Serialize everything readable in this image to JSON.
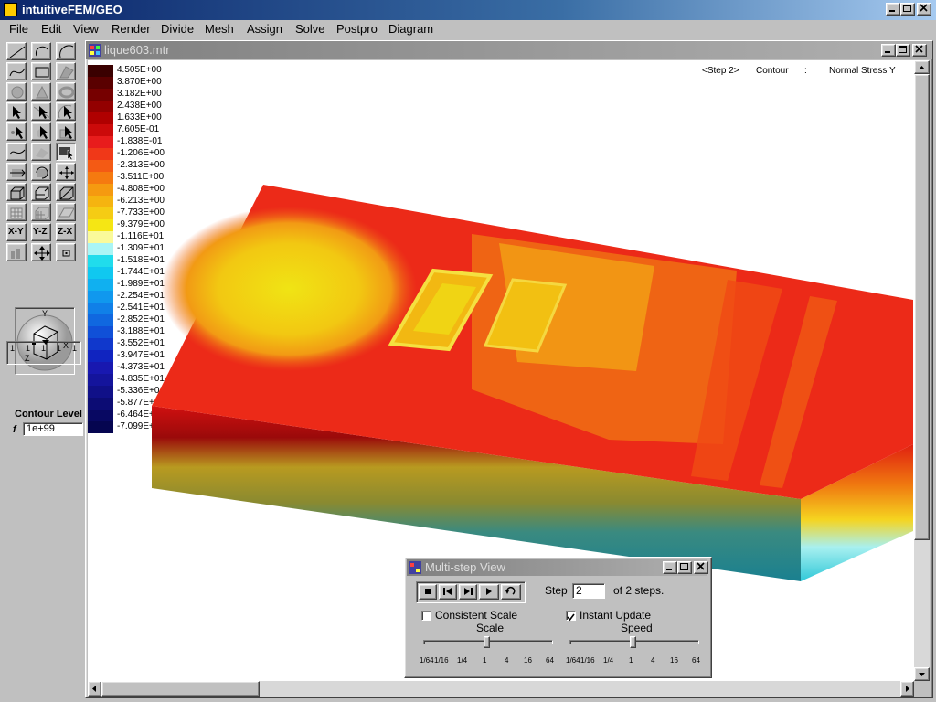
{
  "app": {
    "title": "intuitiveFEM/GEO"
  },
  "menu": [
    "File",
    "Edit",
    "View",
    "Render",
    "Divide",
    "Mesh",
    "Assign",
    "Solve",
    "Postpro",
    "Diagram"
  ],
  "document": {
    "title": "lique603.mtr"
  },
  "status": {
    "step": "<Step 2>",
    "mode": "Contour",
    "sep": ":",
    "quantity": "Normal Stress Y"
  },
  "contour": {
    "label": "Contour Level",
    "f_label": "f",
    "f_value": "1e+99"
  },
  "orbit_axes": {
    "y": "Y",
    "x": "X",
    "z": "Z"
  },
  "plane_buttons": [
    "X-Y",
    "Y-Z",
    "Z-X"
  ],
  "step_gauge": [
    "1",
    "1",
    "1",
    "1",
    "1"
  ],
  "legend": [
    {
      "value": "4.505E+00",
      "color": "#3a0000"
    },
    {
      "value": "3.870E+00",
      "color": "#5a0000"
    },
    {
      "value": "3.182E+00",
      "color": "#760000"
    },
    {
      "value": "2.438E+00",
      "color": "#930000"
    },
    {
      "value": "1.633E+00",
      "color": "#b00000"
    },
    {
      "value": "7.605E-01",
      "color": "#cc0a0a"
    },
    {
      "value": "-1.838E-01",
      "color": "#e81c1c"
    },
    {
      "value": "-1.206E+00",
      "color": "#f03818"
    },
    {
      "value": "-2.313E+00",
      "color": "#f45a14"
    },
    {
      "value": "-3.511E+00",
      "color": "#f57a10"
    },
    {
      "value": "-4.808E+00",
      "color": "#f59a10"
    },
    {
      "value": "-6.213E+00",
      "color": "#f5b410"
    },
    {
      "value": "-7.733E+00",
      "color": "#f5cc14"
    },
    {
      "value": "-9.379E+00",
      "color": "#f5e614"
    },
    {
      "value": "-1.116E+01",
      "color": "#fafa9a"
    },
    {
      "value": "-1.309E+01",
      "color": "#aaf5f5"
    },
    {
      "value": "-1.518E+01",
      "color": "#20dcec"
    },
    {
      "value": "-1.744E+01",
      "color": "#10c8f0"
    },
    {
      "value": "-1.989E+01",
      "color": "#10b0f0"
    },
    {
      "value": "-2.254E+01",
      "color": "#1098ee"
    },
    {
      "value": "-2.541E+01",
      "color": "#1080e8"
    },
    {
      "value": "-2.852E+01",
      "color": "#1068e0"
    },
    {
      "value": "-3.188E+01",
      "color": "#1050d8"
    },
    {
      "value": "-3.552E+01",
      "color": "#1038cc"
    },
    {
      "value": "-3.947E+01",
      "color": "#1024c0"
    },
    {
      "value": "-4.373E+01",
      "color": "#1818b0"
    },
    {
      "value": "-4.835E+01",
      "color": "#14149c"
    },
    {
      "value": "-5.336E+01",
      "color": "#101088"
    },
    {
      "value": "-5.877E+01",
      "color": "#0c0c74"
    },
    {
      "value": "-6.464E+01",
      "color": "#080862"
    },
    {
      "value": "-7.099E+01",
      "color": "#050550"
    }
  ],
  "multistep": {
    "title": "Multi-step View",
    "step_label": "Step",
    "step_value": "2",
    "of_steps": "of 2 steps.",
    "consistent_scale": {
      "label": "Consistent Scale",
      "checked": false
    },
    "instant_update": {
      "label": "Instant Update",
      "checked": true
    },
    "scale_label": "Scale",
    "speed_label": "Speed",
    "scale_ticks": [
      "1/64",
      "1/16",
      "1/4",
      "1",
      "4",
      "16",
      "64"
    ],
    "speed_ticks": [
      "1/64",
      "1/16",
      "1/4",
      "1",
      "4",
      "16",
      "64"
    ],
    "scale_value": "1",
    "speed_value": "1"
  },
  "colors": {
    "title_active": "#0a246a",
    "title_inactive": "#808080",
    "face": "#c0c0c0"
  }
}
